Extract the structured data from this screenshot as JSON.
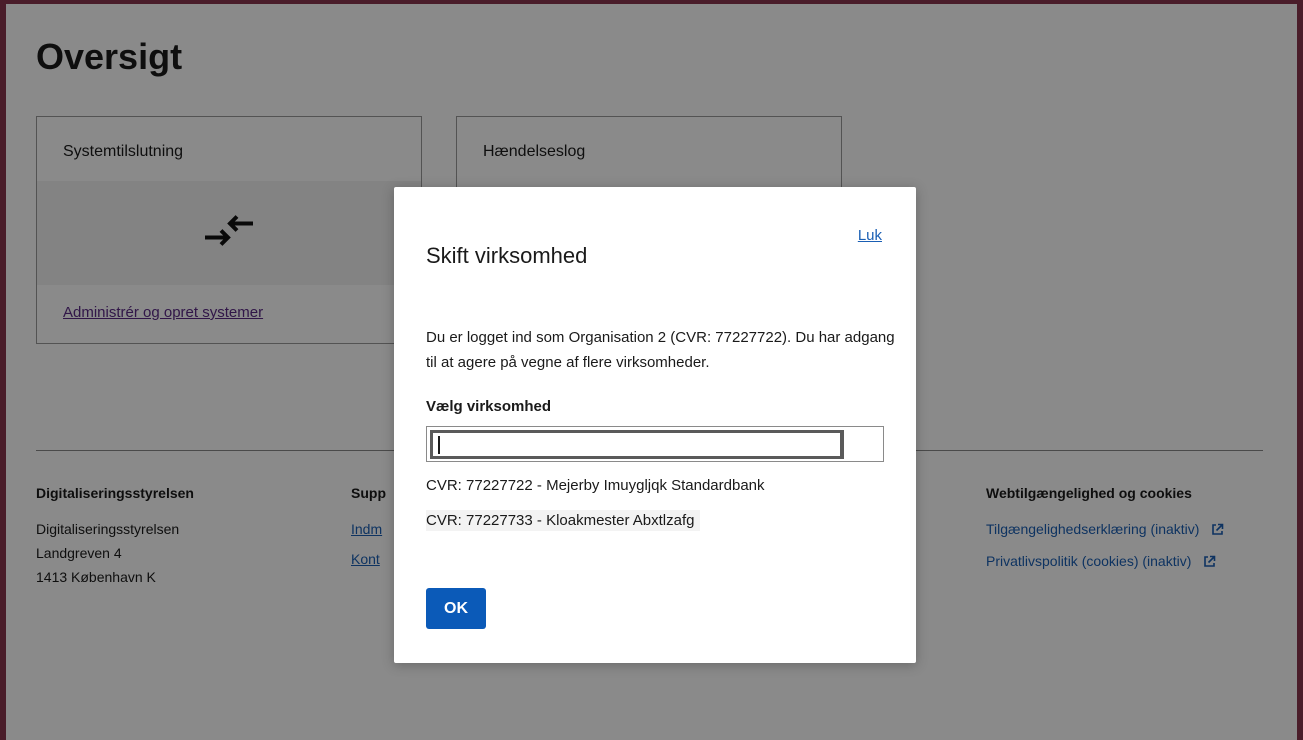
{
  "page": {
    "title": "Oversigt"
  },
  "cards": [
    {
      "title": "Systemtilslutning",
      "icon": "arrows-connect-icon",
      "link": "Administrér og opret systemer"
    },
    {
      "title": "Hændelseslog"
    }
  ],
  "footer": {
    "col1": {
      "heading": "Digitaliseringsstyrelsen",
      "lines": [
        "Digitaliseringsstyrelsen",
        "Landgreven 4",
        "1413 København K"
      ]
    },
    "col2": {
      "heading": "Supp",
      "links": [
        "Indm",
        "Kont"
      ]
    },
    "col3": {
      "heading": "Webtilgængelighed og cookies",
      "links": [
        "Tilgængelighedserklæring (inaktiv)",
        "Privatlivspolitik (cookies) (inaktiv)"
      ]
    }
  },
  "modal": {
    "title": "Skift virksomhed",
    "close_label": "Luk",
    "text": "Du er logget ind som Organisation 2 (CVR: 77227722). Du har adgang til at agere på vegne af flere virksomheder.",
    "field_label": "Vælg virksomhed",
    "input_value": "",
    "options": [
      "CVR: 77227722 - Mejerby Imuygljqk Standardbank",
      "CVR: 77227733 - Kloakmester Abxtlzafg"
    ],
    "ok_label": "OK"
  },
  "colors": {
    "primary": "#0b5ab8",
    "link": "#1a5fb4",
    "visited_link": "#5b2a86",
    "frame": "#4a1d2a"
  }
}
